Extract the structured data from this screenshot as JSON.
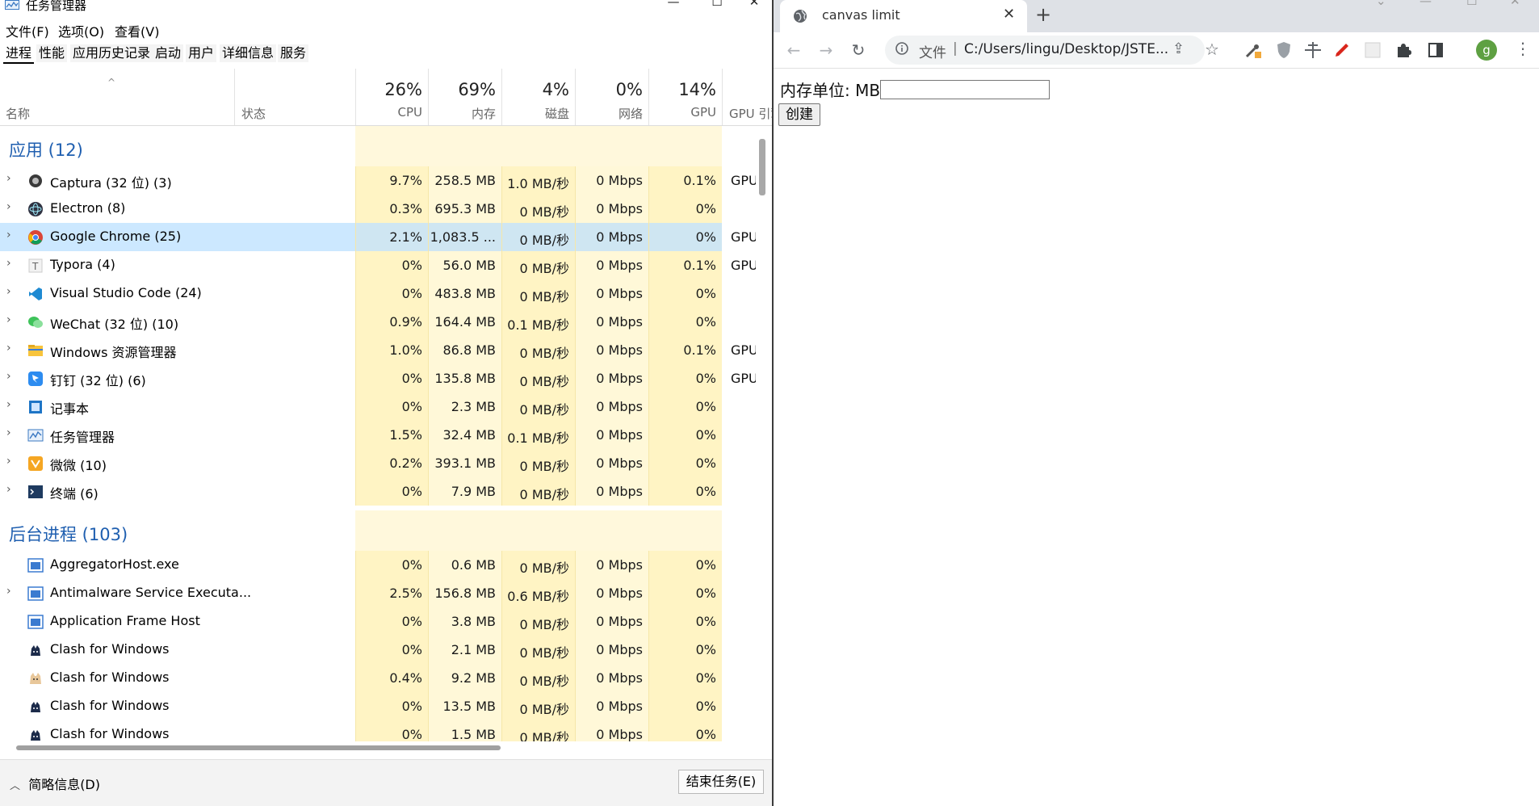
{
  "task_manager": {
    "title": "任务管理器",
    "window_controls": [
      "—",
      "☐",
      "✕"
    ],
    "menu": [
      "文件(F)",
      "选项(O)",
      "查看(V)"
    ],
    "tabs": [
      "进程",
      "性能",
      "应用历史记录",
      "启动",
      "用户",
      "详细信息",
      "服务"
    ],
    "columns": {
      "name": "名称",
      "status": "状态",
      "cpu": {
        "pct": "26%",
        "label": "CPU"
      },
      "memory": {
        "pct": "69%",
        "label": "内存"
      },
      "disk": {
        "pct": "4%",
        "label": "磁盘"
      },
      "network": {
        "pct": "0%",
        "label": "网络"
      },
      "gpu": {
        "pct": "14%",
        "label": "GPU"
      },
      "gpu_engine": "GPU 引擎"
    },
    "groups": [
      {
        "title": "应用 (12)"
      },
      {
        "title": "后台进程 (103)"
      }
    ],
    "apps": [
      {
        "name": "Captura (32 位) (3)",
        "cpu": "9.7%",
        "mem": "258.5 MB",
        "disk": "1.0 MB/秒",
        "net": "0 Mbps",
        "gpu": "0.1%",
        "engine": "GPU",
        "icon": "captura-icon"
      },
      {
        "name": "Electron (8)",
        "cpu": "0.3%",
        "mem": "695.3 MB",
        "disk": "0 MB/秒",
        "net": "0 Mbps",
        "gpu": "0%",
        "engine": "",
        "icon": "electron-icon"
      },
      {
        "name": "Google Chrome (25)",
        "cpu": "2.1%",
        "mem": "1,083.5 ...",
        "disk": "0 MB/秒",
        "net": "0 Mbps",
        "gpu": "0%",
        "engine": "GPU",
        "icon": "chrome-icon"
      },
      {
        "name": "Typora (4)",
        "cpu": "0%",
        "mem": "56.0 MB",
        "disk": "0 MB/秒",
        "net": "0 Mbps",
        "gpu": "0.1%",
        "engine": "GPU",
        "icon": "typora-icon"
      },
      {
        "name": "Visual Studio Code (24)",
        "cpu": "0%",
        "mem": "483.8 MB",
        "disk": "0 MB/秒",
        "net": "0 Mbps",
        "gpu": "0%",
        "engine": "",
        "icon": "vscode-icon"
      },
      {
        "name": "WeChat (32 位) (10)",
        "cpu": "0.9%",
        "mem": "164.4 MB",
        "disk": "0.1 MB/秒",
        "net": "0 Mbps",
        "gpu": "0%",
        "engine": "",
        "icon": "wechat-icon"
      },
      {
        "name": "Windows 资源管理器",
        "cpu": "1.0%",
        "mem": "86.8 MB",
        "disk": "0 MB/秒",
        "net": "0 Mbps",
        "gpu": "0.1%",
        "engine": "GPU",
        "icon": "folder-icon"
      },
      {
        "name": "钉钉 (32 位) (6)",
        "cpu": "0%",
        "mem": "135.8 MB",
        "disk": "0 MB/秒",
        "net": "0 Mbps",
        "gpu": "0%",
        "engine": "GPU",
        "icon": "dingtalk-icon"
      },
      {
        "name": "记事本",
        "cpu": "0%",
        "mem": "2.3 MB",
        "disk": "0 MB/秒",
        "net": "0 Mbps",
        "gpu": "0%",
        "engine": "",
        "icon": "notepad-icon"
      },
      {
        "name": "任务管理器",
        "cpu": "1.5%",
        "mem": "32.4 MB",
        "disk": "0.1 MB/秒",
        "net": "0 Mbps",
        "gpu": "0%",
        "engine": "",
        "icon": "taskmgr-icon"
      },
      {
        "name": "微微 (10)",
        "cpu": "0.2%",
        "mem": "393.1 MB",
        "disk": "0 MB/秒",
        "net": "0 Mbps",
        "gpu": "0%",
        "engine": "",
        "icon": "weiwei-icon"
      },
      {
        "name": "终端 (6)",
        "cpu": "0%",
        "mem": "7.9 MB",
        "disk": "0 MB/秒",
        "net": "0 Mbps",
        "gpu": "0%",
        "engine": "",
        "icon": "terminal-icon"
      }
    ],
    "background": [
      {
        "name": "AggregatorHost.exe",
        "cpu": "0%",
        "mem": "0.6 MB",
        "disk": "0 MB/秒",
        "net": "0 Mbps",
        "gpu": "0%",
        "engine": "",
        "icon": "window-app-icon"
      },
      {
        "name": "Antimalware Service Executa...",
        "cpu": "2.5%",
        "mem": "156.8 MB",
        "disk": "0.6 MB/秒",
        "net": "0 Mbps",
        "gpu": "0%",
        "engine": "",
        "icon": "window-app-icon"
      },
      {
        "name": "Application Frame Host",
        "cpu": "0%",
        "mem": "3.8 MB",
        "disk": "0 MB/秒",
        "net": "0 Mbps",
        "gpu": "0%",
        "engine": "",
        "icon": "window-app-icon"
      },
      {
        "name": "Clash for Windows",
        "cpu": "0%",
        "mem": "2.1 MB",
        "disk": "0 MB/秒",
        "net": "0 Mbps",
        "gpu": "0%",
        "engine": "",
        "icon": "clash-icon"
      },
      {
        "name": "Clash for Windows",
        "cpu": "0.4%",
        "mem": "9.2 MB",
        "disk": "0 MB/秒",
        "net": "0 Mbps",
        "gpu": "0%",
        "engine": "",
        "icon": "clash-cat-icon"
      },
      {
        "name": "Clash for Windows",
        "cpu": "0%",
        "mem": "13.5 MB",
        "disk": "0 MB/秒",
        "net": "0 Mbps",
        "gpu": "0%",
        "engine": "",
        "icon": "clash-icon"
      },
      {
        "name": "Clash for Windows",
        "cpu": "0%",
        "mem": "1.5 MB",
        "disk": "0 MB/秒",
        "net": "0 Mbps",
        "gpu": "0%",
        "engine": "",
        "icon": "clash-icon"
      }
    ],
    "footer": {
      "fewer_details": "简略信息(D)",
      "end_task": "结束任务(E)"
    },
    "colors": {
      "heat_light": "#fff8d8",
      "heat_mid": "#fff4c4",
      "selected": "#cce8ff",
      "group_title": "#1f5fb0"
    }
  },
  "browser": {
    "tab_title": "canvas limit",
    "url_scheme": "文件",
    "url": "C:/Users/lingu/Desktop/JSTE...",
    "profile_initial": "g",
    "page": {
      "label": "内存单位: MB",
      "input_value": "",
      "button": "创建"
    }
  }
}
